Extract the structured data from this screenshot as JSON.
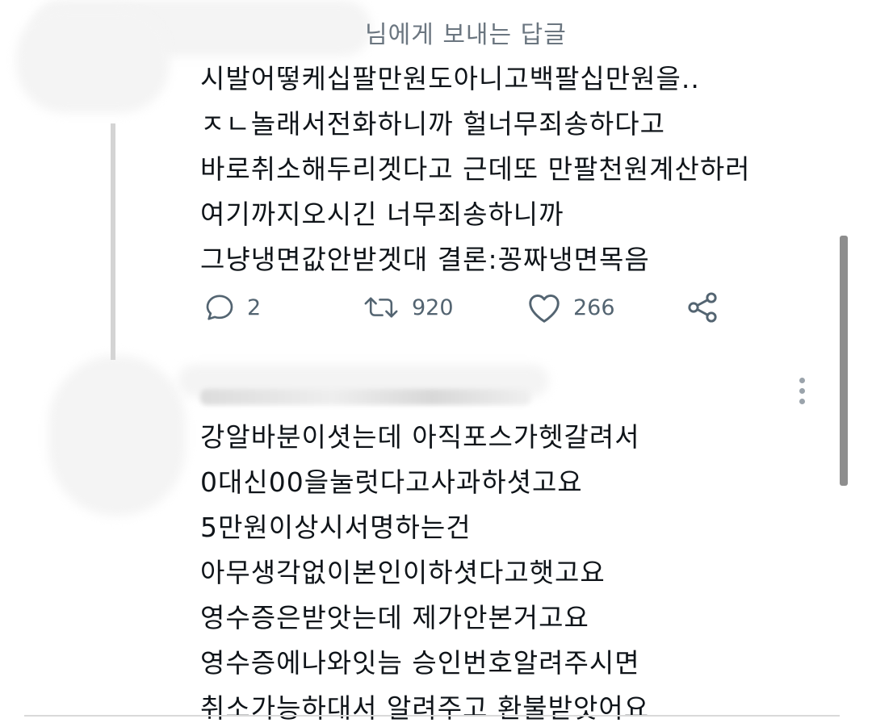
{
  "reply_context": {
    "label": "님에게 보내는 답글"
  },
  "tweet1": {
    "lines": [
      "시발어떻케십팔만원도아니고백팔십만원을..",
      "ㅈㄴ놀래서전화하니까 헐너무죄송하다고",
      "바로취소해두리겟다고 근데또 만팔천원계산하러",
      "여기까지오시긴 너무죄송하니까",
      "그냥냉면값안받겟대 결론:꽁짜냉면목음"
    ],
    "actions": {
      "reply_icon": "reply-icon",
      "reply_count": "2",
      "retweet_icon": "retweet-icon",
      "retweet_count": "920",
      "like_icon": "heart-icon",
      "like_count": "266",
      "share_icon": "share-icon"
    }
  },
  "tweet2": {
    "lines": [
      "강알바분이셧는데 아직포스가헷갈려서",
      "0대신00을눌럿다고사과하셧고요",
      "5만원이상시서명하는건",
      "아무생각없이본인이하셧다고햇고요",
      "영수증은받앗는데 제가안본거고요",
      "영수증에나와잇늠 승인번호알려주시면",
      "취소가능하대서 알려주고 환불받앗어요"
    ],
    "more_icon": "more-vertical-icon"
  },
  "colors": {
    "text": "#0f1419",
    "secondary": "#536471",
    "thread_line": "#d4d4d4"
  }
}
